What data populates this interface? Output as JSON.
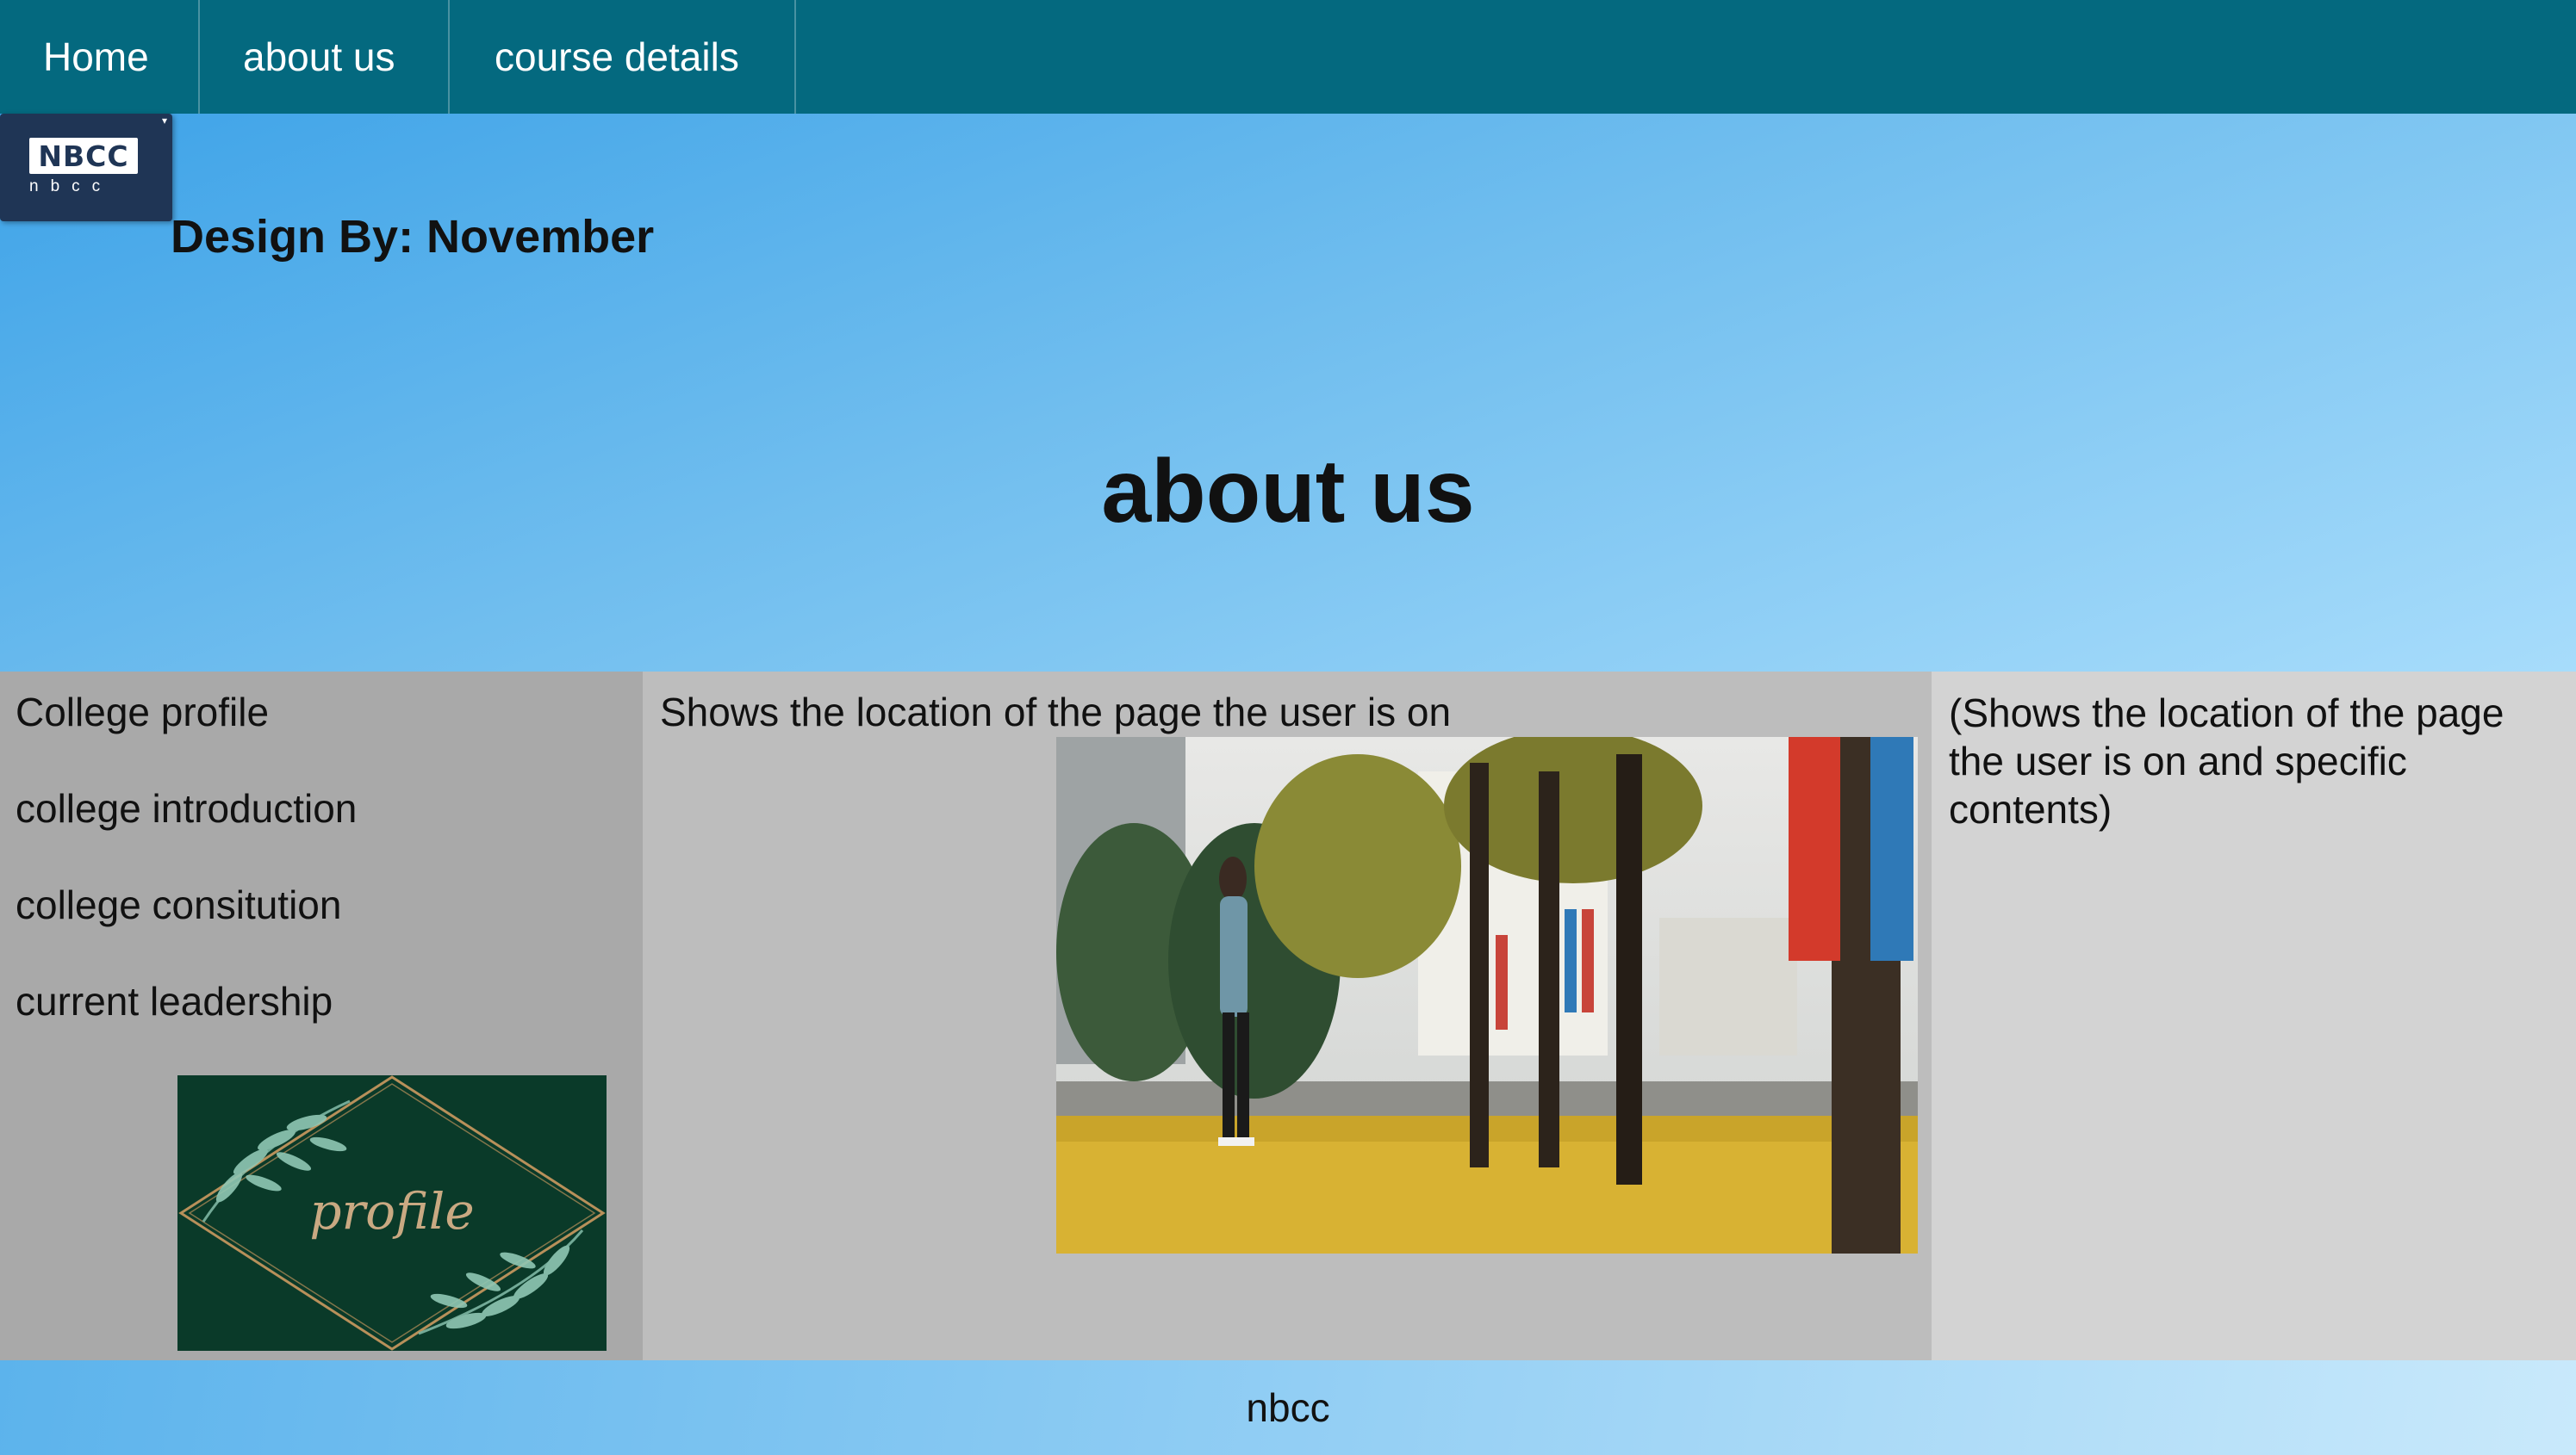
{
  "nav": {
    "items": [
      {
        "label": "Home"
      },
      {
        "label": "about us"
      },
      {
        "label": "course details"
      }
    ]
  },
  "logo": {
    "word": "NBCC",
    "sub": "nbcc"
  },
  "hero": {
    "designer": "Design By: November",
    "title": "about us"
  },
  "sidebar": {
    "links": [
      {
        "label": "College profile"
      },
      {
        "label": "college introduction"
      },
      {
        "label": "college consitution"
      },
      {
        "label": "current leadership"
      }
    ],
    "card_text": "profile"
  },
  "main": {
    "text": "Shows the location of the page the user is on"
  },
  "aside": {
    "text": "(Shows the location of the page the user is on and specific contents)"
  },
  "footer": {
    "text": "nbcc"
  },
  "colors": {
    "nav": "#04697f",
    "sidebar": "#a9a9a9",
    "main": "#bdbdbd",
    "aside": "#d3d3d3"
  }
}
